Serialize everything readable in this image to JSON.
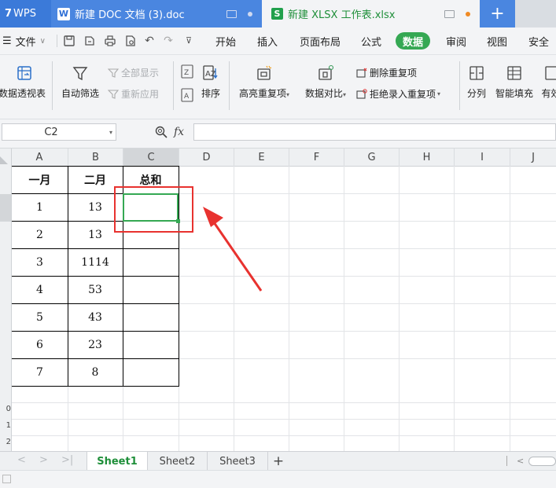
{
  "title_bar": {
    "wps_tab": "WPS",
    "doc_tab": "新建 DOC 文档 (3).doc",
    "xlsx_tab": "新建 XLSX 工作表.xlsx",
    "add_tab": "+"
  },
  "menu": {
    "file": "文件",
    "items": [
      "开始",
      "插入",
      "页面布局",
      "公式",
      "数据",
      "审阅",
      "视图",
      "安全"
    ],
    "active": "数据"
  },
  "ribbon": {
    "pivot_table": "数据透视表",
    "auto_filter": "自动筛选",
    "show_all": "全部显示",
    "reapply": "重新应用",
    "sort": "排序",
    "highlight_duplicates": "高亮重复项",
    "compare_data": "数据对比",
    "remove_duplicates": "删除重复项",
    "reject_duplicates": "拒绝录入重复项",
    "split_column": "分列",
    "flash_fill": "智能填充",
    "validity": "有效"
  },
  "formula_bar": {
    "name_box": "C2",
    "fx_label": "fx",
    "formula": ""
  },
  "grid": {
    "columns": [
      "A",
      "B",
      "C",
      "D",
      "E",
      "F",
      "G",
      "H",
      "I",
      "J"
    ],
    "header_row": [
      "一月",
      "二月",
      "总和"
    ],
    "rows": [
      [
        "1",
        "13",
        ""
      ],
      [
        "2",
        "13",
        ""
      ],
      [
        "3",
        "1114",
        ""
      ],
      [
        "4",
        "53",
        ""
      ],
      [
        "5",
        "43",
        ""
      ],
      [
        "6",
        "23",
        ""
      ],
      [
        "7",
        "8",
        ""
      ]
    ],
    "row_labels_visible": [
      "0",
      "1",
      "2"
    ],
    "selected_cell": "C2"
  },
  "sheets": {
    "tabs": [
      "Sheet1",
      "Sheet2",
      "Sheet3"
    ],
    "active": "Sheet1",
    "add": "+"
  },
  "colors": {
    "accent_green": "#35a853",
    "annotation_red": "#e8322f",
    "title_blue": "#4a86e0"
  }
}
